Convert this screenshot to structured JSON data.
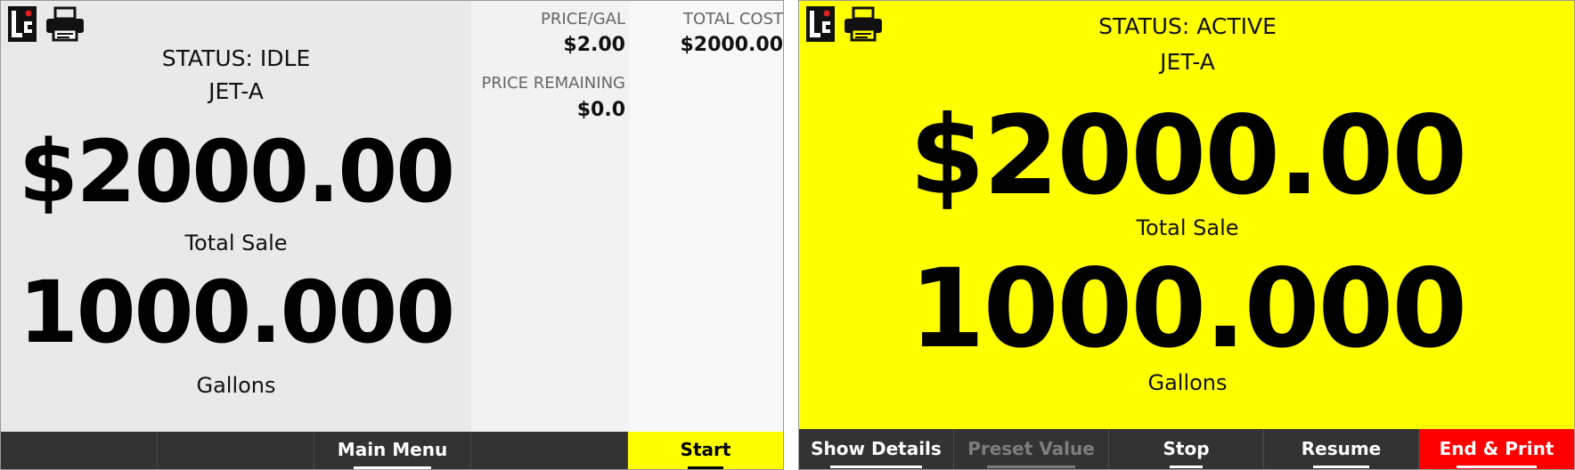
{
  "left_screen": {
    "status": "STATUS: IDLE",
    "fuel_type": "JET-A",
    "total_sale_amount": "$2000.00",
    "total_sale_label": "Total Sale",
    "gallons_amount": "1000.000",
    "gallons_label": "Gallons",
    "details": {
      "price_per_gal_label": "PRICE/GAL",
      "price_per_gal_value": "$2.00",
      "total_cost_label": "TOTAL COST",
      "total_cost_value": "$2000.00",
      "price_remaining_label": "PRICE REMAINING",
      "price_remaining_value": "$0.0"
    },
    "soft_keys": [
      "",
      "",
      "Main Menu",
      "",
      "Start"
    ]
  },
  "right_screen": {
    "status": "STATUS: ACTIVE",
    "fuel_type": "JET-A",
    "total_sale_amount": "$2000.00",
    "total_sale_label": "Total Sale",
    "gallons_amount": "1000.000",
    "gallons_label": "Gallons",
    "soft_keys": [
      "Show Details",
      "Preset Value",
      "Stop",
      "Resume",
      "End & Print"
    ]
  },
  "icons": {
    "logo": "lc-logo-icon",
    "printer": "printer-icon"
  },
  "colors": {
    "active_background": "#ffff00",
    "idle_background": "#e9e9e9",
    "soft_key_bar": "#333333",
    "start_key": "#ffff00",
    "end_print_key": "#ff0000",
    "disabled_key_text": "#7d7d7d"
  }
}
